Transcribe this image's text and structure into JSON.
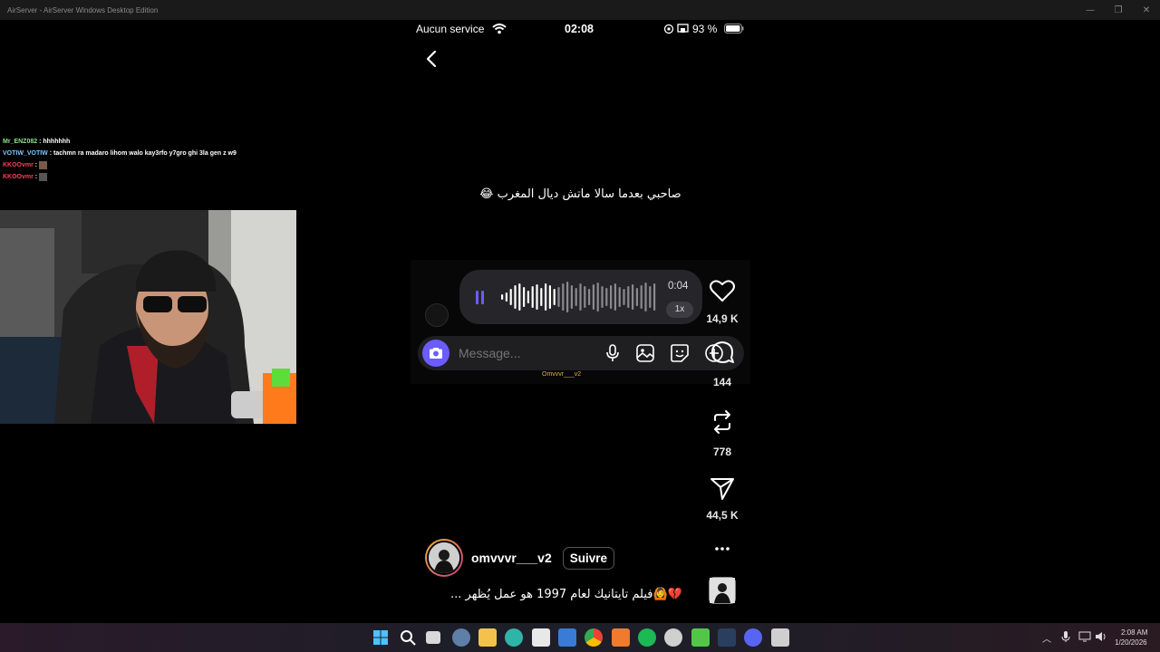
{
  "window": {
    "title": "AirServer - AirServer Windows Desktop Edition"
  },
  "chat": [
    {
      "user": "Mr_ENZ082",
      "text": " : hhhhhhh"
    },
    {
      "user": "VOTIW_VOTIW",
      "text": " : tachmn ra madaro lihom walo kay3rfo y7gro ghi 3la gen z w9"
    },
    {
      "user": "KKOOvmr",
      "text": " : "
    },
    {
      "user": "KKOOvmr",
      "text": " : "
    }
  ],
  "status_bar": {
    "carrier": "Aucun service",
    "time": "02:08",
    "battery": "93 %"
  },
  "post": {
    "overlay_text": "صاحبي بعدما سالا ماتش ديال المغرب 😂",
    "voice": {
      "duration": "0:04",
      "speed": "1x"
    },
    "message_placeholder": "Message...",
    "watermark": "Omvvvr___v2",
    "likes": "14,9 K",
    "comments": "144",
    "reposts": "778",
    "shares": "44,5 K",
    "username": "omvvvr___v2",
    "follow_label": "Suivre",
    "caption": "💔🙆فيلم تايتانيك لعام 1997 هو عمل يُظهر ..."
  },
  "taskbar": {
    "time": "2:08 AM",
    "date": "1/20/2026"
  },
  "colors": {
    "accent": "#6b5cff",
    "bubble": "#26262a",
    "background": "#000000"
  }
}
